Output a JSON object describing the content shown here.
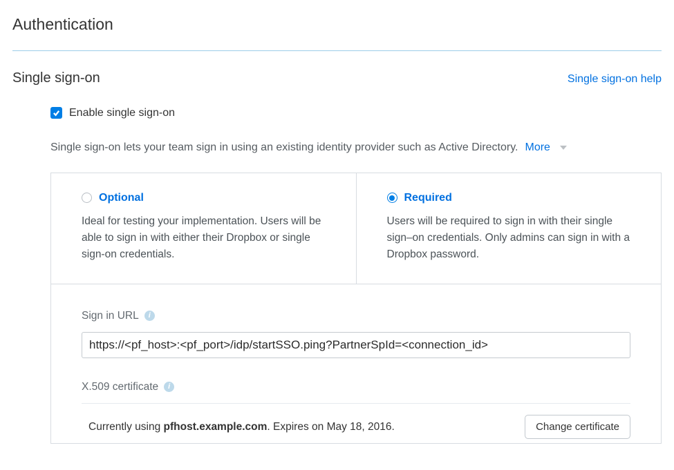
{
  "page": {
    "title": "Authentication"
  },
  "section": {
    "title": "Single sign-on",
    "help_link": "Single sign-on help"
  },
  "enable": {
    "label": "Enable single sign-on",
    "checked": true
  },
  "description": {
    "text": "Single sign-on lets your team sign in using an existing identity provider such as Active Directory.",
    "more_label": "More"
  },
  "options": {
    "optional": {
      "title": "Optional",
      "desc": "Ideal for testing your implementation. Users will be able to sign in with either their Dropbox or single sign-on credentials.",
      "selected": false
    },
    "required": {
      "title": "Required",
      "desc": "Users will be required to sign in with their single sign–on credentials. Only admins can sign in with a Dropbox password.",
      "selected": true
    }
  },
  "signin": {
    "label": "Sign in URL",
    "value": "https://<pf_host>:<pf_port>/idp/startSSO.ping?PartnerSpId=<connection_id>"
  },
  "cert": {
    "label": "X.509 certificate",
    "prefix": "Currently using ",
    "host": "pfhost.example.com",
    "suffix": ". Expires on May 18, 2016.",
    "button": "Change certificate"
  }
}
